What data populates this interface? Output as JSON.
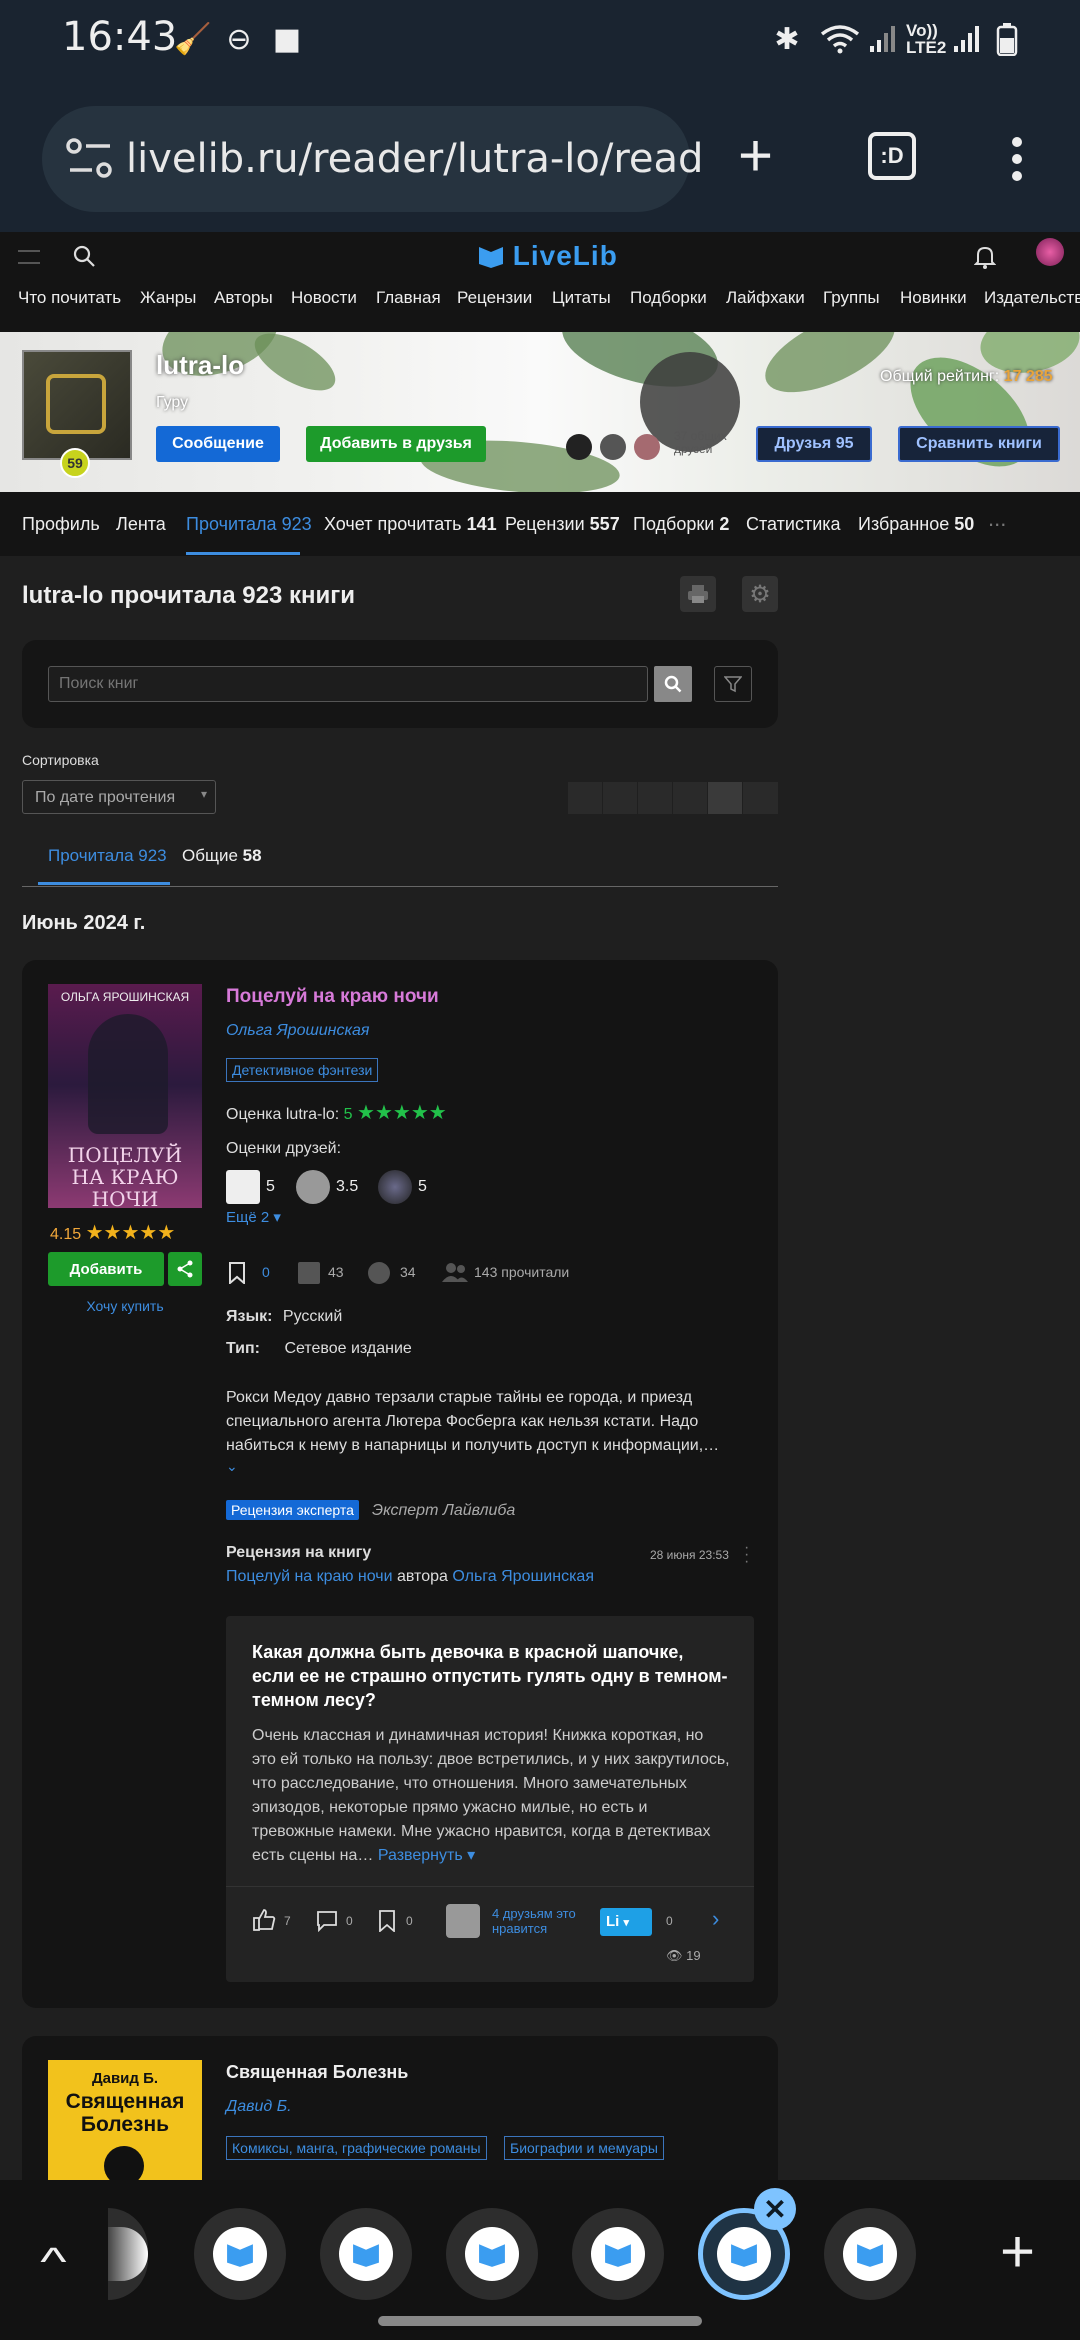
{
  "status": {
    "time": "16:43",
    "network": "Vo))\nLTE2"
  },
  "browser": {
    "url": "livelib.ru/reader/lutra-lo/read",
    "tab_count": ":D"
  },
  "site": {
    "logo": "LiveLib",
    "nav": [
      "Что почитать",
      "Жанры",
      "Авторы",
      "Новости",
      "Главная",
      "Рецензии",
      "Цитаты",
      "Подборки",
      "Лайфхаки",
      "Группы",
      "Новинки",
      "Издательств"
    ]
  },
  "profile": {
    "name": "lutra-lo",
    "rank": "Гуру",
    "level": "59",
    "rating_label": "Общий рейтинг:",
    "rating_value": "17 285",
    "message_btn": "Сообщение",
    "add_friend_btn": "Добавить в друзья",
    "common_friends": "37 общих друзей",
    "friends_btn": "Друзья 95",
    "compare_btn": "Сравнить книги"
  },
  "tabs": [
    {
      "label": "Профиль",
      "count": ""
    },
    {
      "label": "Лента",
      "count": ""
    },
    {
      "label": "Прочитала",
      "count": "923"
    },
    {
      "label": "Хочет прочитать",
      "count": "141"
    },
    {
      "label": "Рецензии",
      "count": "557"
    },
    {
      "label": "Подборки",
      "count": "2"
    },
    {
      "label": "Статистика",
      "count": ""
    },
    {
      "label": "Избранное",
      "count": "50"
    }
  ],
  "more_dots": "...",
  "heading": "lutra-lo прочитала 923 книги",
  "search": {
    "placeholder": "Поиск книг"
  },
  "sort": {
    "label": "Сортировка",
    "value": "По дате прочтения"
  },
  "subtabs": [
    {
      "label": "Прочитала",
      "count": "923"
    },
    {
      "label": "Общие",
      "count": "58"
    }
  ],
  "month": "Июнь 2024 г.",
  "book1": {
    "cover_author": "ОЛЬГА ЯРОШИНСКАЯ",
    "cover_title": "ПОЦЕЛУЙ НА КРАЮ НОЧИ",
    "title": "Поцелуй на краю ночи",
    "author": "Ольга Ярошинская",
    "genre": "Детективное фэнтези",
    "user_rating_label": "Оценка lutra-lo:",
    "user_rating": "5",
    "friends_label": "Оценки друзей:",
    "friend_ratings": [
      "5",
      "3.5",
      "5"
    ],
    "more": "Ещё 2",
    "avg": "4.15",
    "add_btn": "Добавить",
    "buy": "Хочу купить",
    "stats": {
      "saved": "0",
      "shelves": "43",
      "reviews": "34",
      "readers": "143 прочитали"
    },
    "lang_label": "Язык:",
    "lang": "Русский",
    "type_label": "Тип:",
    "type": "Сетевое издание",
    "desc": "Рокси Медоу давно терзали старые тайны ее города, и приезд специального агента Лютера Фосберга как нельзя кстати. Надо набиться к нему в напарницы и получить доступ к информации,…",
    "expert_badge": "Рецензия эксперта",
    "expert_name": "Эксперт Лайвлиба",
    "review_label": "Рецензия на книгу",
    "review_date": "28 июня 23:53",
    "review_book": "Поцелуй на краю ночи",
    "review_author_word": "автора",
    "review_author": "Ольга Ярошинская",
    "review_title": "Какая должна быть девочка в красной шапочке, если ее не страшно отпустить гулять одну в темном-темном лесу?",
    "review_text": "Очень классная и динамичная история! Книжка короткая, но это ей только на пользу: двое встретились, и у них закрутилось, что расследование, что отношения. Много замечательных эпизодов, некоторые прямо ужасно милые, но есть и тревожные намеки. Мне ужасно нравится, когда в детективах есть сцены на…",
    "expand": "Развернуть",
    "likes": "7",
    "comments": "0",
    "bookmarks": "0",
    "friends_like": "4 друзьям это нравится",
    "li_count": "0",
    "views": "19"
  },
  "book2": {
    "cover_author": "Давид Б.",
    "cover_title": "Священная Болезнь",
    "title": "Священная Болезнь",
    "author": "Давид Б.",
    "genres": [
      "Комиксы, манга, графические романы",
      "Биографии и мемуары"
    ]
  }
}
